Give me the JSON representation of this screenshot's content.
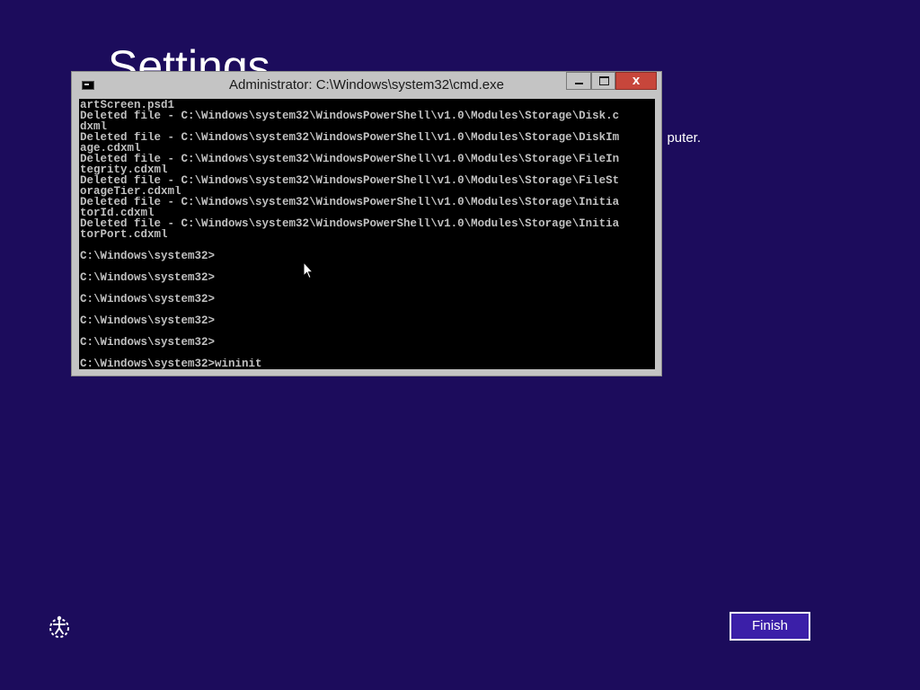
{
  "background": {
    "color": "#1c0c5c",
    "title": "Settings",
    "partial_text": "puter."
  },
  "cmd": {
    "title": "Administrator: C:\\Windows\\system32\\cmd.exe",
    "close_glyph": "x",
    "lines": [
      "artScreen.psd1",
      "Deleted file - C:\\Windows\\system32\\WindowsPowerShell\\v1.0\\Modules\\Storage\\Disk.c",
      "dxml",
      "Deleted file - C:\\Windows\\system32\\WindowsPowerShell\\v1.0\\Modules\\Storage\\DiskIm",
      "age.cdxml",
      "Deleted file - C:\\Windows\\system32\\WindowsPowerShell\\v1.0\\Modules\\Storage\\FileIn",
      "tegrity.cdxml",
      "Deleted file - C:\\Windows\\system32\\WindowsPowerShell\\v1.0\\Modules\\Storage\\FileSt",
      "orageTier.cdxml",
      "Deleted file - C:\\Windows\\system32\\WindowsPowerShell\\v1.0\\Modules\\Storage\\Initia",
      "torId.cdxml",
      "Deleted file - C:\\Windows\\system32\\WindowsPowerShell\\v1.0\\Modules\\Storage\\Initia",
      "torPort.cdxml",
      "",
      "C:\\Windows\\system32>",
      "",
      "C:\\Windows\\system32>",
      "",
      "C:\\Windows\\system32>",
      "",
      "C:\\Windows\\system32>",
      "",
      "C:\\Windows\\system32>",
      "",
      "C:\\Windows\\system32>wininit"
    ]
  },
  "footer": {
    "finish_label": "Finish",
    "ease_icon": "ease-of-access-icon"
  },
  "colors": {
    "accent": "#3b1fa8",
    "close": "#c7463b",
    "console_bg": "#000000",
    "console_text": "#c0c0c0"
  }
}
